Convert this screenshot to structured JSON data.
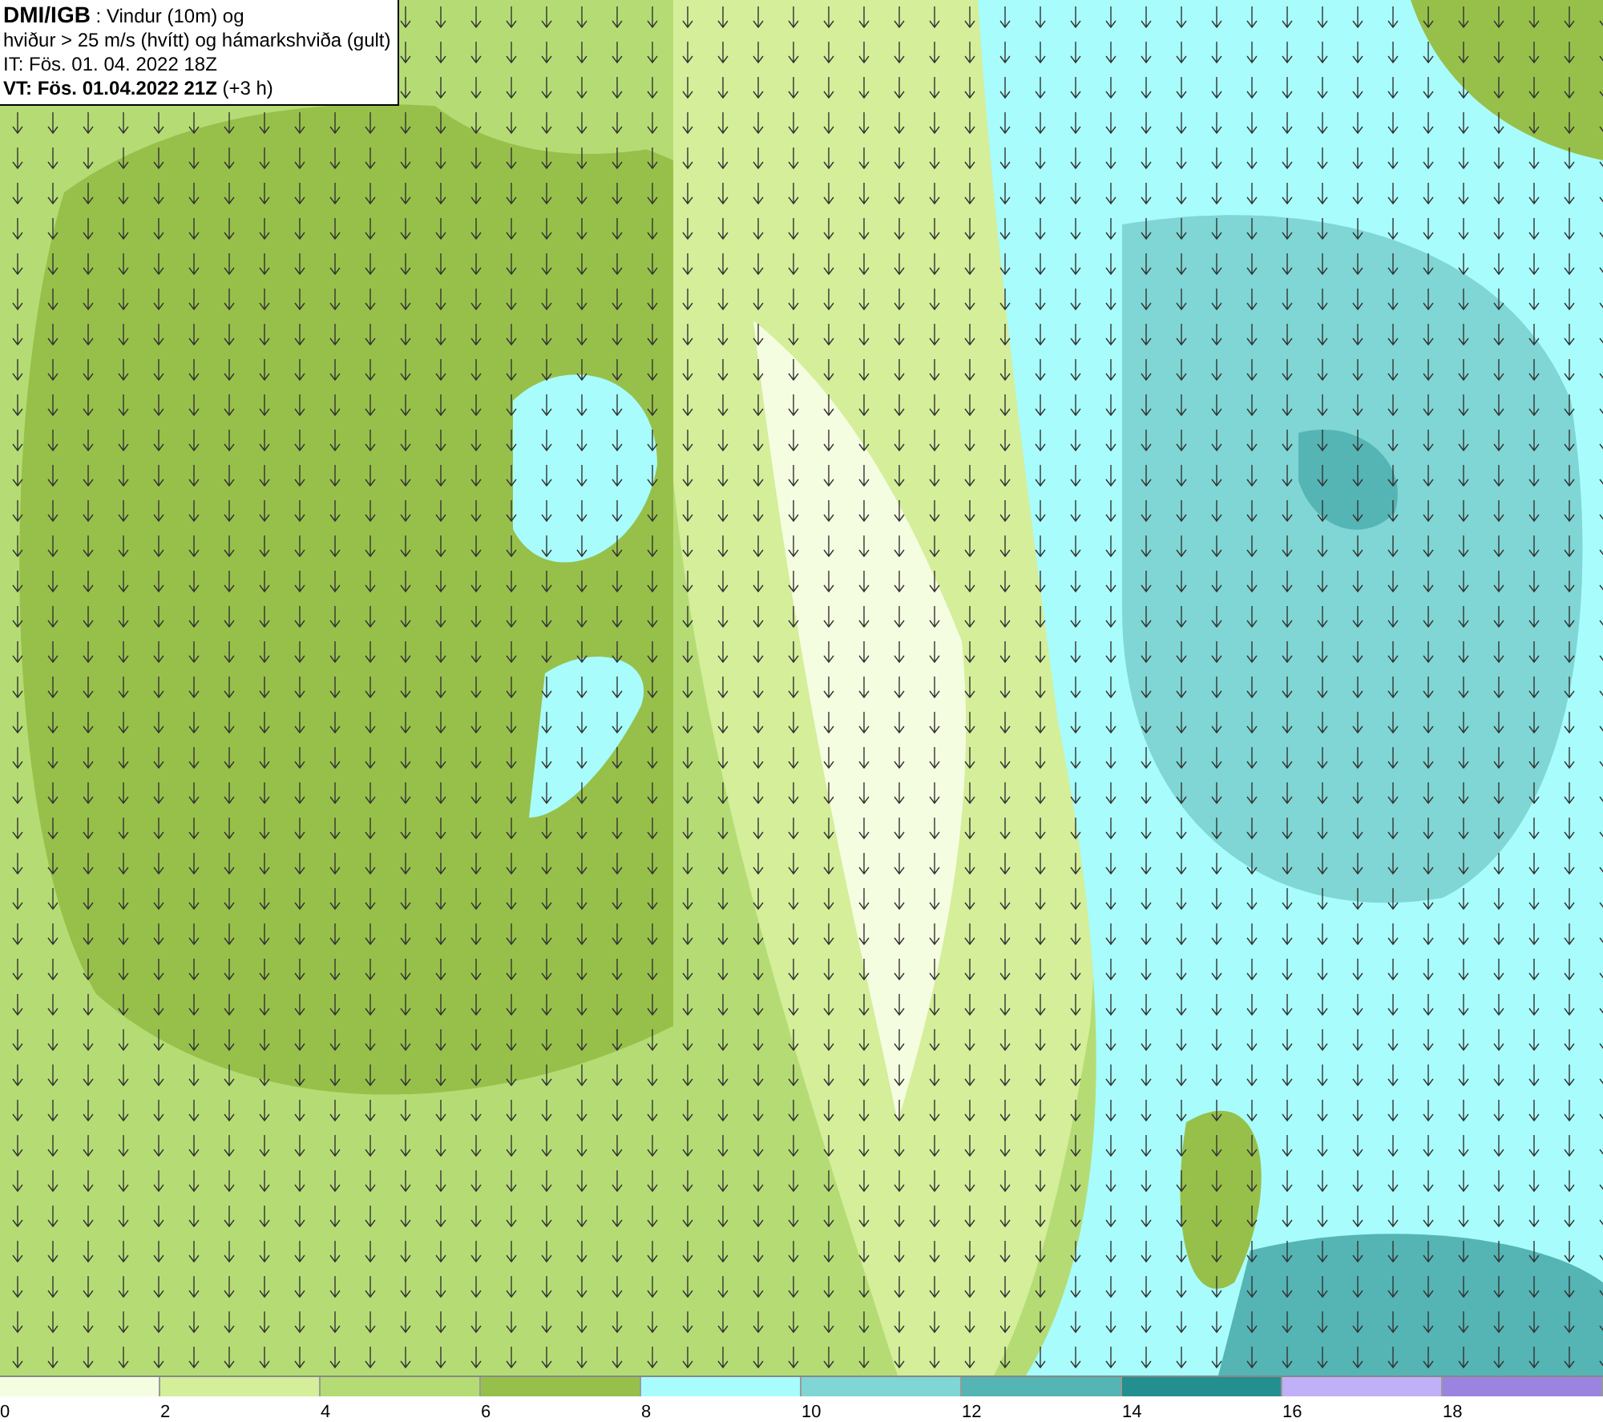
{
  "title_box": {
    "lines": [
      "**DMI/IGB** : Vindur (10m) og",
      "hviður > 25 m/s (hvítt) og hámarkshviða (gult)",
      "IT: Fös. 01. 04. 2022 18Z",
      "**VT: Fös. 01.04.2022 21Z** (+3 h)"
    ]
  },
  "legend": {
    "bins": [
      {
        "label": "0",
        "color": "#f5fde0"
      },
      {
        "label": "2",
        "color": "#d4ee9a"
      },
      {
        "label": "4",
        "color": "#b5dc74"
      },
      {
        "label": "6",
        "color": "#97c04a"
      },
      {
        "label": "8",
        "color": "#a8fcfc"
      },
      {
        "label": "10",
        "color": "#7fd6d4"
      },
      {
        "label": "12",
        "color": "#55b4b4"
      },
      {
        "label": "14",
        "color": "#238f8e"
      },
      {
        "label": "16",
        "color": "#bfb0f8"
      },
      {
        "label": "18",
        "color": "#9a84e0"
      }
    ]
  }
}
